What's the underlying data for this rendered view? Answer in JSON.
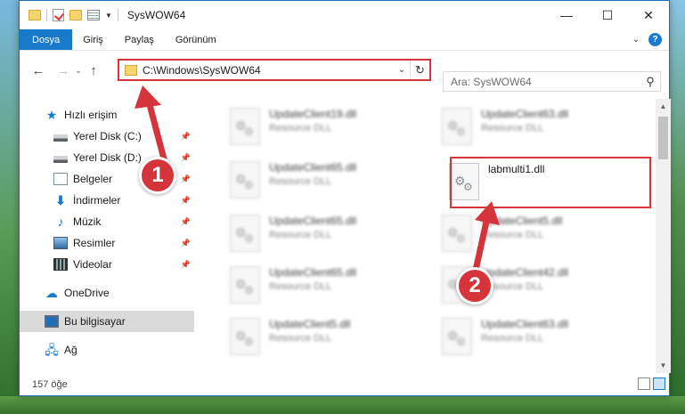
{
  "window": {
    "title": "SysWOW64",
    "controls": {
      "minimize": "—",
      "maximize": "☐",
      "close": "✕"
    }
  },
  "ribbon": {
    "tabs": [
      "Dosya",
      "Giriş",
      "Paylaş",
      "Görünüm"
    ],
    "help": "?"
  },
  "navigation": {
    "address": "C:\\Windows\\SysWOW64",
    "search_placeholder": "Ara: SysWOW64"
  },
  "sidebar": {
    "items": [
      {
        "label": "Hızlı erişim",
        "icon": "star-icon"
      },
      {
        "label": "Yerel Disk (C:)",
        "icon": "drive-icon",
        "pinned": true
      },
      {
        "label": "Yerel Disk (D:)",
        "icon": "drive-icon",
        "pinned": true
      },
      {
        "label": "Belgeler",
        "icon": "documents-icon",
        "pinned": true
      },
      {
        "label": "İndirmeler",
        "icon": "downloads-icon",
        "pinned": true
      },
      {
        "label": "Müzik",
        "icon": "music-icon",
        "pinned": true
      },
      {
        "label": "Resimler",
        "icon": "pictures-icon",
        "pinned": true
      },
      {
        "label": "Videolar",
        "icon": "videos-icon",
        "pinned": true
      },
      {
        "label": "OneDrive",
        "icon": "cloud-icon"
      },
      {
        "label": "Bu bilgisayar",
        "icon": "computer-icon",
        "selected": true
      },
      {
        "label": "Ağ",
        "icon": "network-icon"
      }
    ]
  },
  "files": {
    "highlighted": {
      "name": "labmulti1.dll",
      "type": ""
    },
    "left_column": [
      {
        "name": "UpdateClient19.dll",
        "type": "Resource DLL"
      },
      {
        "name": "UpdateClient65.dll",
        "type": "Resource DLL"
      },
      {
        "name": "UpdateClient65.dll",
        "type": "Resource DLL"
      },
      {
        "name": "UpdateClient65.dll",
        "type": "Resource DLL"
      },
      {
        "name": "UpdateClient5.dll",
        "type": "Resource DLL"
      }
    ],
    "right_column": [
      {
        "name": "UpdateClient63.dll",
        "type": "Resource DLL"
      },
      {
        "name": "UpdateClient5.dll",
        "type": "Resource DLL"
      },
      {
        "name": "UpdateClient42.dll",
        "type": "Resource DLL"
      },
      {
        "name": "UpdateClient63.dll",
        "type": "Resource DLL"
      }
    ]
  },
  "status": {
    "count": "157 öğe"
  },
  "annotations": {
    "step1": "1",
    "step2": "2",
    "color": "#d6343b"
  }
}
